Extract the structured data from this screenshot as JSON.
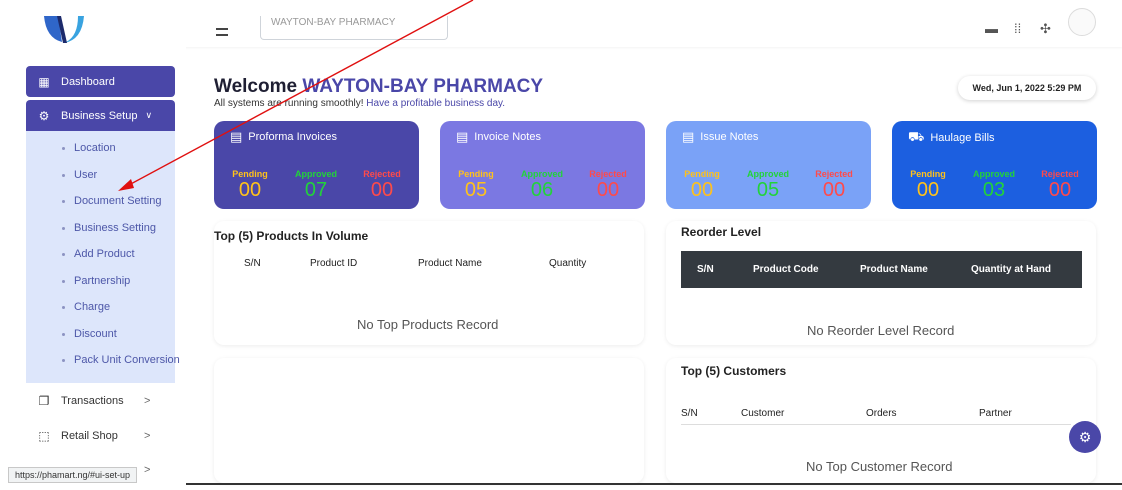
{
  "header": {
    "store_select_value": "WAYTON-BAY PHARMACY",
    "icons": [
      "menu-icon",
      "grid-icon",
      "bell-icon",
      "user-avatar"
    ]
  },
  "sidebar": {
    "dashboard": "Dashboard",
    "business_setup": "Business Setup",
    "submenu": [
      "Location",
      "User",
      "Document Setting",
      "Business Setting",
      "Add Product",
      "Partnership",
      "Charge",
      "Discount",
      "Pack Unit Conversion"
    ],
    "transactions": "Transactions",
    "retail_shop": "Retail Shop"
  },
  "status_url": "https://phamart.ng/#ui-set-up",
  "welcome": {
    "prefix": "Welcome",
    "name": "WAYTON-BAY PHARMACY",
    "subtitle_a": "All systems are running smoothly!",
    "subtitle_b": "Have a profitable business day."
  },
  "date": "Wed, Jun 1, 2022 5:29 PM",
  "cards": [
    {
      "title": "Proforma Invoices",
      "icon": "document-icon",
      "bg": "#4a47a8",
      "labels": [
        "Pending",
        "Approved",
        "Rejected"
      ],
      "values": [
        "00",
        "07",
        "00"
      ]
    },
    {
      "title": "Invoice Notes",
      "icon": "document-icon",
      "bg": "#7b78e2",
      "labels": [
        "Pending",
        "Approved",
        "Rejected"
      ],
      "values": [
        "05",
        "06",
        "00"
      ]
    },
    {
      "title": "Issue Notes",
      "icon": "document-icon",
      "bg": "#7aa2f7",
      "labels": [
        "Pending",
        "Approved",
        "Rejected"
      ],
      "values": [
        "00",
        "05",
        "00"
      ]
    },
    {
      "title": "Haulage Bills",
      "icon": "truck-icon",
      "bg": "#1c5fe0",
      "labels": [
        "Pending",
        "Approved",
        "Rejected"
      ],
      "values": [
        "00",
        "03",
        "00"
      ]
    }
  ],
  "stat_colors": {
    "pending": "#ffc21a",
    "approved": "#22d33a",
    "rejected": "#ff4a4a"
  },
  "top_products": {
    "title": "Top (5) Products In Volume",
    "columns": [
      "S/N",
      "Product ID",
      "Product Name",
      "Quantity"
    ],
    "empty": "No Top Products Record"
  },
  "reorder": {
    "title": "Reorder Level",
    "columns": [
      "S/N",
      "Product Code",
      "Product Name",
      "Quantity at Hand"
    ],
    "empty": "No Reorder Level Record"
  },
  "top_customers": {
    "title": "Top (5) Customers",
    "columns": [
      "S/N",
      "Customer",
      "Orders",
      "Partner"
    ],
    "empty": "No Top Customer Record"
  }
}
